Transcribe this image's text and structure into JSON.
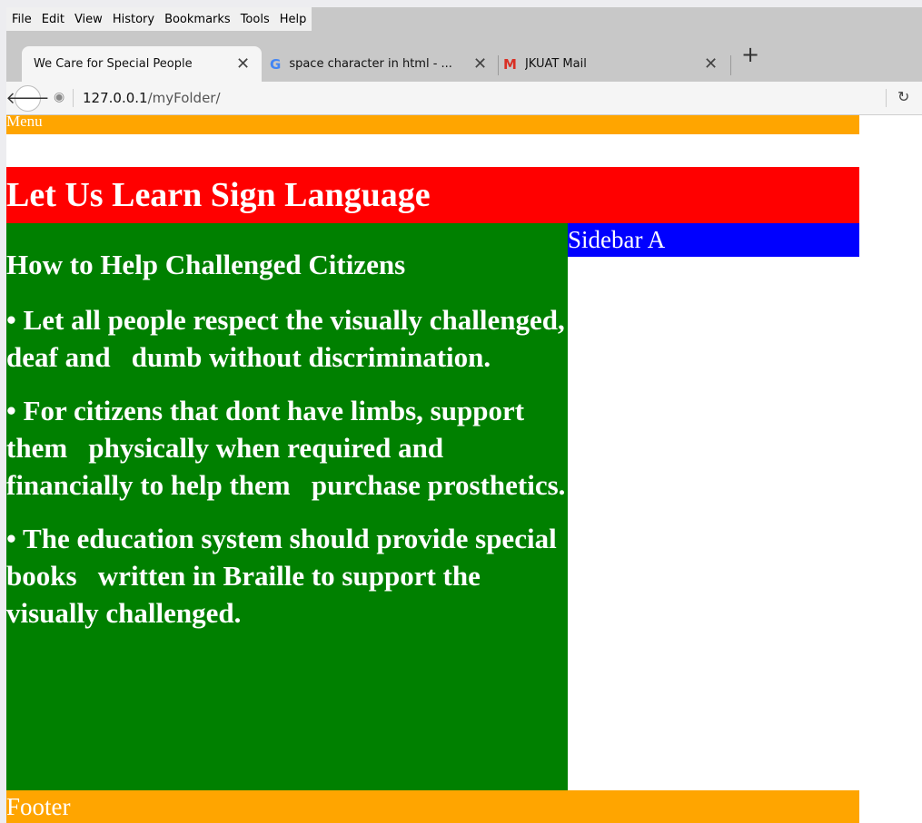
{
  "browser": {
    "menu": [
      "File",
      "Edit",
      "View",
      "History",
      "Bookmarks",
      "Tools",
      "Help"
    ],
    "tabs": [
      {
        "title": "We Care for Special People",
        "active": true,
        "icon": "none"
      },
      {
        "title": "space character in html - ...",
        "active": false,
        "icon": "google-icon"
      },
      {
        "title": "JKUAT Mail",
        "active": false,
        "icon": "gmail-icon"
      }
    ],
    "new_tab_label": "+",
    "url_host": "127.0.0.1",
    "url_path": "/myFolder/"
  },
  "page": {
    "menu_label": "Menu",
    "header_title": "Let Us Learn Sign Language",
    "main_heading": "How to Help Challenged Citizens",
    "paragraphs": [
      "• Let all people respect the visually challenged, deaf and   dumb without discrimination.",
      "• For citizens that dont have limbs, support them   physically when required and financially to help them   purchase prosthetics.",
      "• The education system should provide special books   written in Braille to support the visually challenged."
    ],
    "sidebar_label": "Sidebar A",
    "footer_label": "Footer"
  },
  "colors": {
    "menu_strip": "#ffa500",
    "header": "#ff0000",
    "main": "#008000",
    "sidebar": "#0000ff",
    "footer": "#ffa500"
  }
}
